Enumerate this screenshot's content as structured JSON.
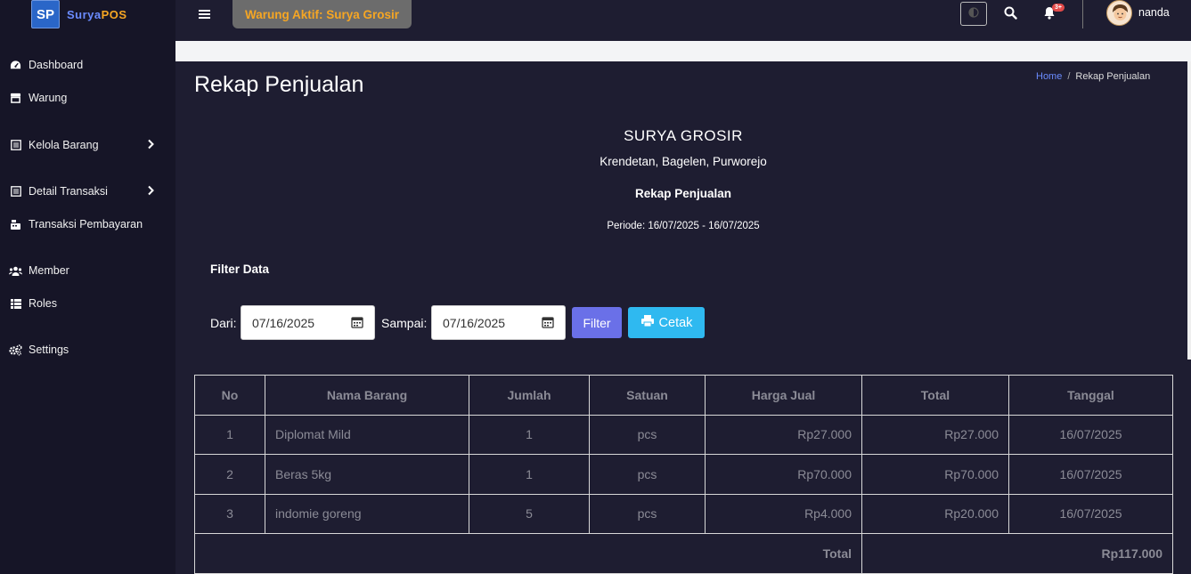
{
  "brand": {
    "logo": "SP",
    "name_part1": "Surya",
    "name_part2": "POS"
  },
  "sidebar": {
    "items": [
      {
        "label": "Dashboard",
        "icon": "dashboard-icon"
      },
      {
        "label": "Warung",
        "icon": "store-icon"
      },
      {
        "label": "Kelola Barang",
        "icon": "list-icon",
        "has_submenu": true
      },
      {
        "label": "Detail Transaksi",
        "icon": "list-icon",
        "has_submenu": true
      },
      {
        "label": "Transaksi Pembayaran",
        "icon": "cash-register-icon"
      },
      {
        "label": "Member",
        "icon": "users-icon"
      },
      {
        "label": "Roles",
        "icon": "list-icon"
      },
      {
        "label": "Settings",
        "icon": "gears-icon"
      }
    ]
  },
  "topbar": {
    "active_store": "Warung Aktif: Surya Grosir",
    "notification_badge": "3+",
    "username": "nanda"
  },
  "page": {
    "title": "Rekap Penjualan",
    "breadcrumb": {
      "home": "Home",
      "current": "Rekap Penjualan"
    }
  },
  "report": {
    "company": "SURYA GROSIR",
    "address": "Krendetan, Bagelen, Purworejo",
    "title": "Rekap Penjualan",
    "period": "Periode: 16/07/2025 - 16/07/2025"
  },
  "filter": {
    "title": "Filter Data",
    "from_label": "Dari:",
    "from_value": "07/16/2025",
    "to_label": "Sampai:",
    "to_value": "07/16/2025",
    "filter_button": "Filter",
    "print_button": "Cetak"
  },
  "table": {
    "headers": [
      "No",
      "Nama Barang",
      "Jumlah",
      "Satuan",
      "Harga Jual",
      "Total",
      "Tanggal"
    ],
    "rows": [
      [
        "1",
        "Diplomat Mild",
        "1",
        "pcs",
        "Rp27.000",
        "Rp27.000",
        "16/07/2025"
      ],
      [
        "2",
        "Beras 5kg",
        "1",
        "pcs",
        "Rp70.000",
        "Rp70.000",
        "16/07/2025"
      ],
      [
        "3",
        "indomie goreng",
        "5",
        "pcs",
        "Rp4.000",
        "Rp20.000",
        "16/07/2025"
      ]
    ],
    "total_label": "Total",
    "total_value": "Rp117.000"
  },
  "colors": {
    "background": "#1e1d31",
    "sidebar": "#161527",
    "accent_orange": "#f6a623",
    "filter_button": "#6a70e8",
    "print_button": "#2fb9f0"
  }
}
